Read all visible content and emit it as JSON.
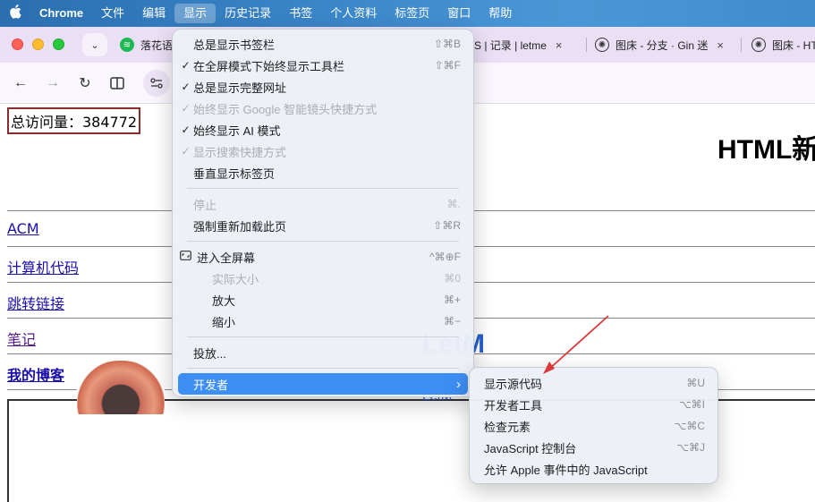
{
  "menubar": {
    "apple": "",
    "items": [
      "Chrome",
      "文件",
      "编辑",
      "显示",
      "历史记录",
      "书签",
      "个人资料",
      "标签页",
      "窗口",
      "帮助"
    ]
  },
  "tabs": [
    {
      "title": "落花语",
      "close": "×"
    },
    {
      "title": "S | 记录 | letme",
      "close": "×"
    },
    {
      "title": "图床 - 分支 · Gin 迷",
      "close": "×"
    },
    {
      "title": "图床 - HT",
      "close": ""
    }
  ],
  "page": {
    "visits": "总访问量：384772",
    "title": "HTML新",
    "links": [
      "ACM",
      "计算机代码",
      "跳转链接",
      "笔记",
      "我的博客"
    ],
    "blog_title": "LetM",
    "blog_sub": "LetM"
  },
  "view_menu": {
    "items": [
      {
        "check": "",
        "label": "总是显示书签栏",
        "shortcut": "⇧⌘B",
        "disabled": false
      },
      {
        "check": "✓",
        "label": "在全屏模式下始终显示工具栏",
        "shortcut": "⇧⌘F",
        "disabled": false
      },
      {
        "check": "✓",
        "label": "总是显示完整网址",
        "shortcut": "",
        "disabled": false
      },
      {
        "check": "✓",
        "label": "始终显示 Google 智能镜头快捷方式",
        "shortcut": "",
        "disabled": true
      },
      {
        "check": "✓",
        "label": "始终显示 AI 模式",
        "shortcut": "",
        "disabled": false
      },
      {
        "check": "✓",
        "label": "显示搜索快捷方式",
        "shortcut": "",
        "disabled": true
      },
      {
        "check": "",
        "label": "垂直显示标签页",
        "shortcut": "",
        "disabled": false
      },
      {
        "check": "",
        "label": "停止",
        "shortcut": "⌘.",
        "disabled": true
      },
      {
        "check": "",
        "label": "强制重新加载此页",
        "shortcut": "⇧⌘R",
        "disabled": false
      },
      {
        "check": "",
        "label": "进入全屏幕",
        "shortcut": "^⌘⊕F",
        "disabled": false
      },
      {
        "check": "",
        "label": "实际大小",
        "shortcut": "⌘0",
        "disabled": true
      },
      {
        "check": "",
        "label": "放大",
        "shortcut": "⌘+",
        "disabled": false
      },
      {
        "check": "",
        "label": "缩小",
        "shortcut": "⌘−",
        "disabled": false
      },
      {
        "check": "",
        "label": "投放...",
        "shortcut": "",
        "disabled": false
      },
      {
        "check": "",
        "label": "开发者",
        "shortcut": "›",
        "disabled": false
      }
    ]
  },
  "developer_menu": {
    "items": [
      {
        "label": "显示源代码",
        "shortcut": "⌘U"
      },
      {
        "label": "开发者工具",
        "shortcut": "⌥⌘I"
      },
      {
        "label": "检查元素",
        "shortcut": "⌥⌘C"
      },
      {
        "label": "JavaScript 控制台",
        "shortcut": "⌥⌘J"
      },
      {
        "label": "允许 Apple 事件中的 JavaScript",
        "shortcut": ""
      }
    ]
  },
  "colors": {
    "menubar": "#3a86c8",
    "highlight": "#3d8ef2",
    "arrow": "#d93a3a"
  }
}
